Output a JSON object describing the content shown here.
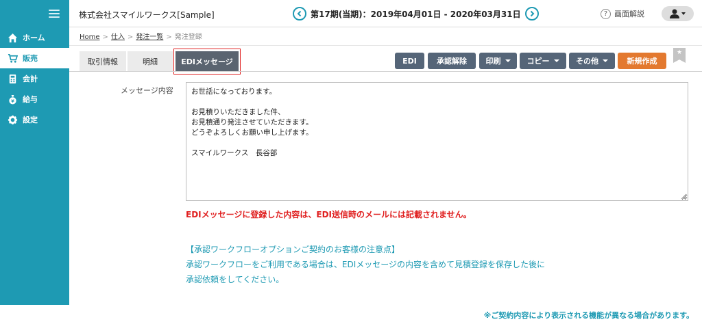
{
  "sidebar": {
    "items": [
      {
        "label": "ホーム",
        "icon": "home-icon"
      },
      {
        "label": "販売",
        "icon": "cart-icon"
      },
      {
        "label": "会計",
        "icon": "calculator-icon"
      },
      {
        "label": "給与",
        "icon": "money-bag-icon"
      },
      {
        "label": "設定",
        "icon": "gear-icon"
      }
    ],
    "active_index": 1
  },
  "header": {
    "company": "株式会社スマイルワークス[Sample]",
    "period": "第17期(当期)：2019年04月01日 - 2020年03月31日",
    "help_label": "画面解説"
  },
  "breadcrumb": {
    "items": [
      "Home",
      "仕入",
      "発注一覧",
      "発注登録"
    ],
    "separator": ">"
  },
  "tabs": [
    {
      "label": "取引情報"
    },
    {
      "label": "明細"
    },
    {
      "label": "EDIメッセージ"
    }
  ],
  "actions": {
    "edi": "EDI",
    "unapprove": "承認解除",
    "print": "印刷",
    "copy": "コピー",
    "other": "その他",
    "new": "新規作成"
  },
  "content": {
    "message_label": "メッセージ内容",
    "message_text": "お世話になっております。\n\nお見積りいただきました件、\nお見積通り発注させていただきます。\nどうぞよろしくお願い申し上げます。\n\nスマイルワークス　長谷部",
    "warning": "EDIメッセージに登録した内容は、EDI送信時のメールには記載されません。",
    "note_title": "【承認ワークフローオプションご契約のお客様の注意点】",
    "note_line1": "承認ワークフローをご利用である場合は、EDIメッセージの内容を含めて見積登録を保存した後に",
    "note_line2": "承認依頼をしてください。",
    "footer": "※ご契約内容により表示される機能が異なる場合があります。"
  },
  "colors": {
    "sidebar": "#1e9ab3",
    "button": "#556578",
    "new_button": "#e3792f",
    "warning": "#e02020",
    "note": "#1e9ab3"
  }
}
